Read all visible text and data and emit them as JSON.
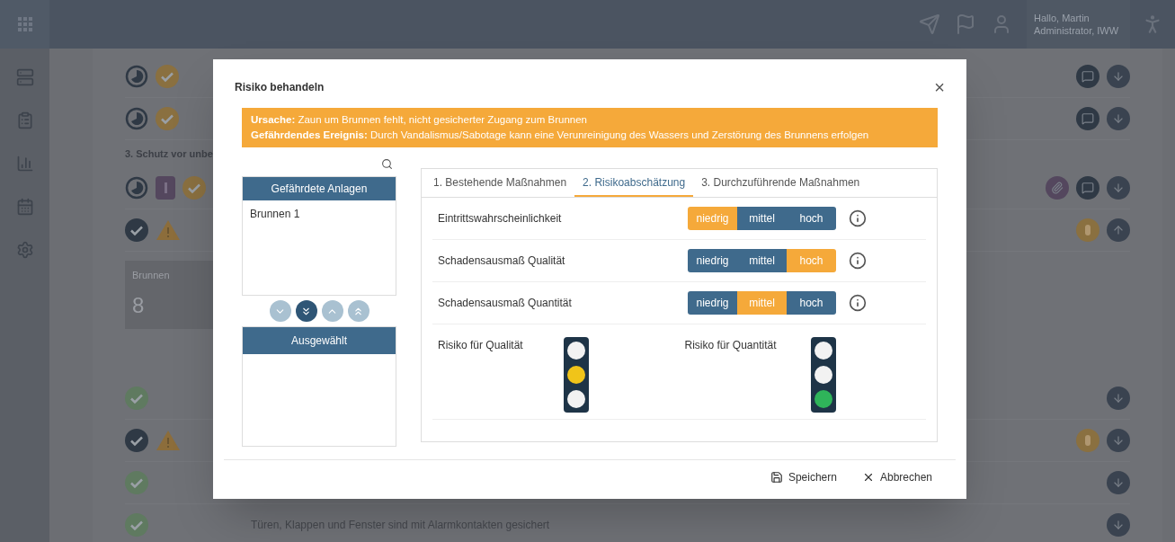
{
  "header": {
    "greeting": "Hallo, Martin",
    "role": "Administrator, IWW"
  },
  "background": {
    "section_heading": "3. Schutz vor unbe",
    "tile": {
      "label": "Brunnen",
      "value": "8"
    },
    "last_row_text": "Türen, Klappen und Fenster sind mit Alarmkontakten gesichert"
  },
  "dialog": {
    "title": "Risiko behandeln",
    "close": "×",
    "alert": [
      "**Ursache:** Zaun um Brunnen fehlt, nicht gesicherter Zugang zum Brunnen",
      "**Gefährdendes Ereignis:** Durch Vandalismus/Sabotage kann eine Verunreinigung des Wassers und Zerstörung des Brunnens erfolgen"
    ],
    "available_list": {
      "title": "Gefährdete Anlagen",
      "items": [
        "Brunnen 1"
      ]
    },
    "transfer_buttons": [
      {
        "disabled": true
      },
      {
        "disabled": false
      },
      {
        "disabled": true
      },
      {
        "disabled": true
      }
    ],
    "selected_list": {
      "title": "Ausgewählt"
    },
    "tabs": [
      {
        "label": "1. Bestehende Maßnahmen",
        "selected": false
      },
      {
        "label": "2. Risikoabschätzung",
        "selected": true
      },
      {
        "label": "3. Durchzuführende Maßnahmen",
        "selected": false
      }
    ],
    "ratings": [
      {
        "label": "Eintrittswahrscheinlichkeit",
        "options": [
          {
            "label": "niedrig",
            "selected": true
          },
          {
            "label": "mittel",
            "selected": false
          },
          {
            "label": "hoch",
            "selected": false
          }
        ]
      },
      {
        "label": "Schadensausmaß Qualität",
        "options": [
          {
            "label": "niedrig",
            "selected": false
          },
          {
            "label": "mittel",
            "selected": false
          },
          {
            "label": "hoch",
            "selected": true
          }
        ]
      },
      {
        "label": "Schadensausmaß Quantität",
        "options": [
          {
            "label": "niedrig",
            "selected": false
          },
          {
            "label": "mittel",
            "selected": true
          },
          {
            "label": "hoch",
            "selected": false
          }
        ]
      }
    ],
    "risks": [
      {
        "label": "Risiko für Qualität",
        "lamps": [
          {
            "on": false
          },
          {
            "on": true
          },
          {
            "on": false
          }
        ]
      },
      {
        "label": "Risiko für Quantität",
        "lamps": [
          {
            "on": false
          },
          {
            "on": false
          },
          {
            "on": true
          }
        ]
      }
    ],
    "footer": [
      {
        "kind": "save",
        "label": "Speichern"
      },
      {
        "kind": "cancel",
        "label": "Abbrechen"
      }
    ]
  }
}
